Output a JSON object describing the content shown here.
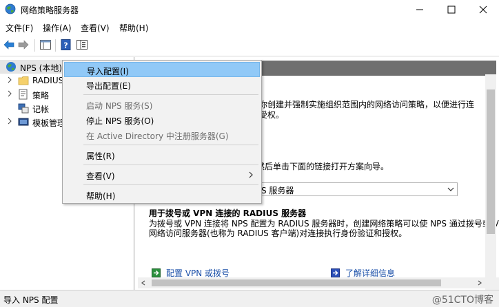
{
  "window": {
    "title": "网络策略服务器"
  },
  "menubar": {
    "items": [
      "文件(F)",
      "操作(A)",
      "查看(V)",
      "帮助(H)"
    ]
  },
  "tree": {
    "root": "NPS (本地)",
    "items": [
      "RADIUS",
      "策略",
      "记帐",
      "模板管理"
    ]
  },
  "context_menu": {
    "items": [
      {
        "label": "导入配置(I)",
        "state": "highlighted"
      },
      {
        "label": "导出配置(E)",
        "state": "normal"
      },
      {
        "label": "启动 NPS 服务(S)",
        "state": "disabled"
      },
      {
        "label": "停止 NPS 服务(O)",
        "state": "normal"
      },
      {
        "label": "在 Active Directory 中注册服务器(G)",
        "state": "disabled"
      },
      {
        "label": "属性(R)",
        "state": "normal"
      },
      {
        "label": "查看(V)",
        "state": "submenu"
      },
      {
        "label": "帮助(H)",
        "state": "normal"
      }
    ]
  },
  "main": {
    "intro_line1": "你创建并强制实施组织范围内的网络访问策略，以便进行连",
    "intro_line2": "受权。",
    "instruction": "然后单击下面的链接打开方案向导。",
    "combo_value": "S 服务器",
    "section_title": "用于拨号或 VPN 连接的 RADIUS 服务器",
    "section_desc1": "为拨号或 VPN 连接将 NPS 配置为 RADIUS 服务器时，创建网络策略可以使 NPS 通过拨号或 V",
    "section_desc2": "网络访问服务器(也称为 RADIUS 客户端)对连接执行身份验证和授权。",
    "link_configure": "配置 VPN 或拨号",
    "link_learn_more": "了解详细信息"
  },
  "statusbar": {
    "text": "导入 NPS 配置",
    "watermark": "@51CTO博客"
  },
  "colors": {
    "highlight": "#91c9f7",
    "link": "#1a4fa8",
    "header_bar": "#6f6f6f"
  }
}
